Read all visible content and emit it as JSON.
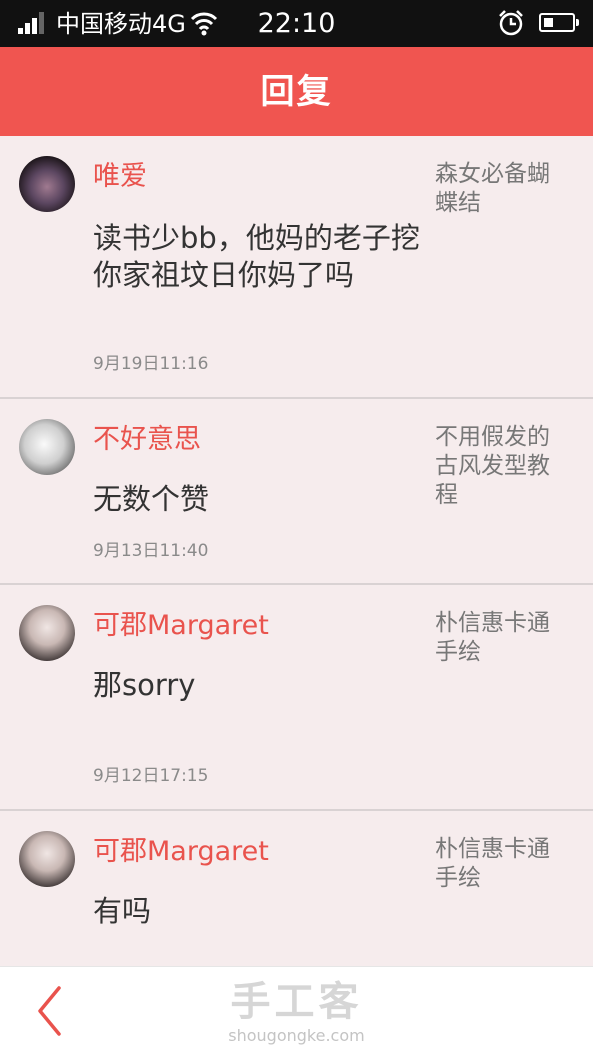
{
  "status_bar": {
    "carrier": "中国移动4G",
    "time": "22:10",
    "icons": [
      "signal-icon",
      "wifi-icon",
      "alarm-icon",
      "battery-icon"
    ]
  },
  "header": {
    "title": "回复"
  },
  "replies": [
    {
      "username": "唯爱",
      "content": "读书少bb，他妈的老子挖你家祖坟日你妈了吗",
      "time": "9月19日11:16",
      "topic": "森女必备蝴蝶结"
    },
    {
      "username": "不好意思",
      "content": "无数个赞",
      "time": "9月13日11:40",
      "topic": "不用假发的古风发型教程"
    },
    {
      "username": "可郡Margaret",
      "content": "那sorry",
      "time": "9月12日17:15",
      "topic": "朴信惠卡通手绘"
    },
    {
      "username": "可郡Margaret",
      "content": "有吗",
      "time": "",
      "topic": "朴信惠卡通手绘"
    }
  ],
  "bottom_bar": {
    "back_icon": "chevron-left-icon",
    "logo_text": "手工客",
    "logo_url_text": "shougongke.com"
  },
  "colors": {
    "accent": "#f05550",
    "username": "#e9534d",
    "background": "#f6eced",
    "status_bar": "#111111"
  }
}
